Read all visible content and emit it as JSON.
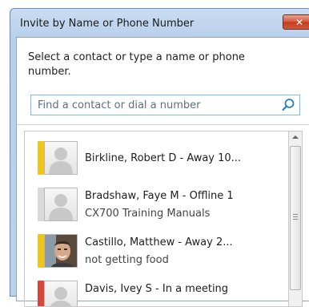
{
  "dialog": {
    "title": "Invite by Name or Phone Number",
    "close_glyph": "✕",
    "instruction": "Select a contact or type a name or phone number.",
    "search_placeholder": "Find a contact or dial a number"
  },
  "contacts": [
    {
      "name": "Birkline, Robert D - Away 10...",
      "note": "",
      "presence_color": "#f2c519",
      "avatar": "placeholder-person-icon"
    },
    {
      "name": "Bradshaw, Faye M - Offline 1",
      "note": "CX700 Training Manuals",
      "presence_color": "#d9d9d9",
      "avatar": "placeholder-person-icon"
    },
    {
      "name": "Castillo, Matthew - Away 2...",
      "note": "not getting food",
      "presence_color": "#f2c519",
      "avatar": "photo"
    },
    {
      "name": "Davis, Ivey S - In a meeting",
      "note": "",
      "presence_color": "#d9463a",
      "avatar": "placeholder-person-icon"
    }
  ],
  "colors": {
    "titlebar": "#c2d7ef",
    "close_button": "#c9462a",
    "search_border": "#7bbbe6",
    "away": "#f2c519",
    "busy": "#d9463a",
    "offline": "#d9d9d9"
  }
}
